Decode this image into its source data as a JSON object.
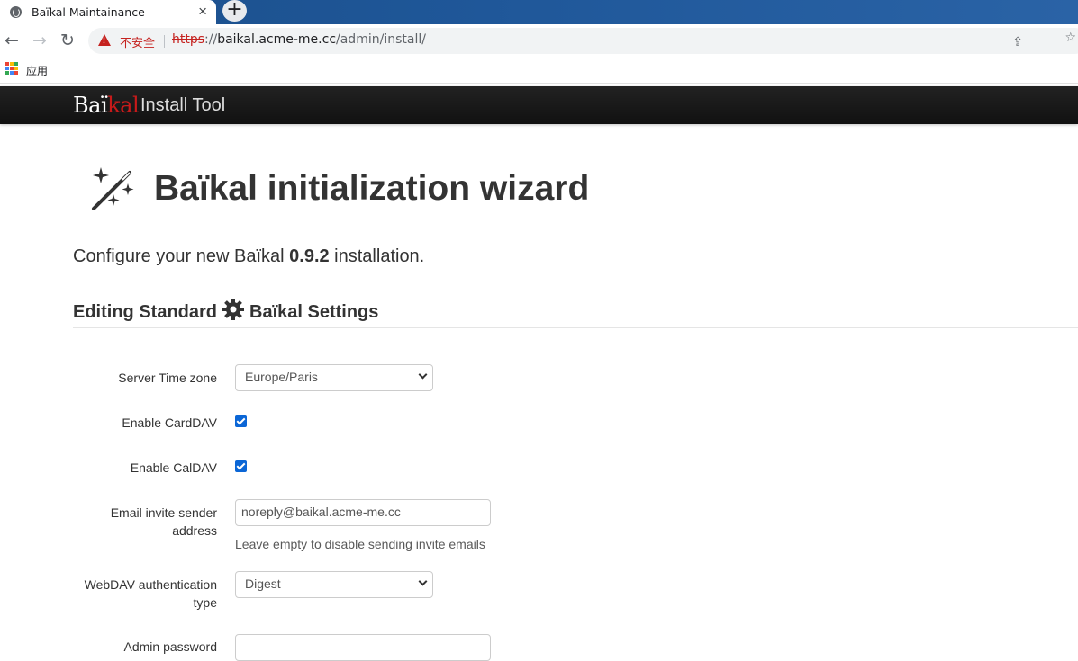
{
  "browser": {
    "tab_title": "Baïkal Maintainance",
    "tab_close": "×",
    "new_tab": "+",
    "insecure_label": "不安全",
    "url_scheme": "https",
    "url_separator": "://",
    "url_host": "baikal.acme-me.cc",
    "url_path": "/admin/install/",
    "bookmark_apps_label": "应用"
  },
  "navbar": {
    "brand_part1": "Baï",
    "brand_part2": "kal",
    "brand_sub": "Install Tool"
  },
  "page": {
    "title": "Baïkal initialization wizard",
    "lead_prefix": "Configure your new Baïkal ",
    "version": "0.9.2",
    "lead_suffix": " installation.",
    "section_prefix": "Editing Standard",
    "section_strong": "Baïkal Settings"
  },
  "form": {
    "timezone": {
      "label": "Server Time zone",
      "value": "Europe/Paris"
    },
    "carddav": {
      "label": "Enable CardDAV",
      "checked": true
    },
    "caldav": {
      "label": "Enable CalDAV",
      "checked": true
    },
    "email": {
      "label_line1": "Email invite sender",
      "label_line2": "address",
      "value": "noreply@baikal.acme-me.cc",
      "help": "Leave empty to disable sending invite emails"
    },
    "auth": {
      "label_line1": "WebDAV authentication",
      "label_line2": "type",
      "value": "Digest"
    },
    "admin_password": {
      "label": "Admin password"
    }
  },
  "colors": {
    "brand_accent": "#c81a1a",
    "checkbox": "#0b66d6",
    "insecure": "#c5221f",
    "tabbar": "#1f5799"
  }
}
